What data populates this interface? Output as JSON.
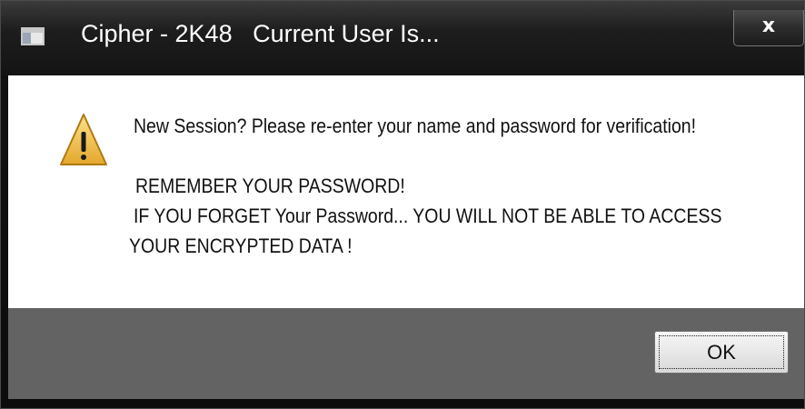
{
  "window": {
    "title": "Cipher - 2K48   Current User Is...",
    "close_label": "x"
  },
  "message": {
    "line1": "New Session? Please re-enter your name and password for verification!",
    "line2": "REMEMBER YOUR PASSWORD!",
    "line3": "IF YOU FORGET Your Password... YOU WILL NOT BE ABLE TO ACCESS",
    "line4": "YOUR ENCRYPTED DATA !"
  },
  "icons": {
    "app": "app-window-icon",
    "warning": "warning-icon"
  },
  "buttons": {
    "ok_label": "OK"
  },
  "colors": {
    "titlebar": "#1a1a1a",
    "content_bg": "#ffffff",
    "button_area": "#636363",
    "warning_yellow": "#f2c14e"
  }
}
